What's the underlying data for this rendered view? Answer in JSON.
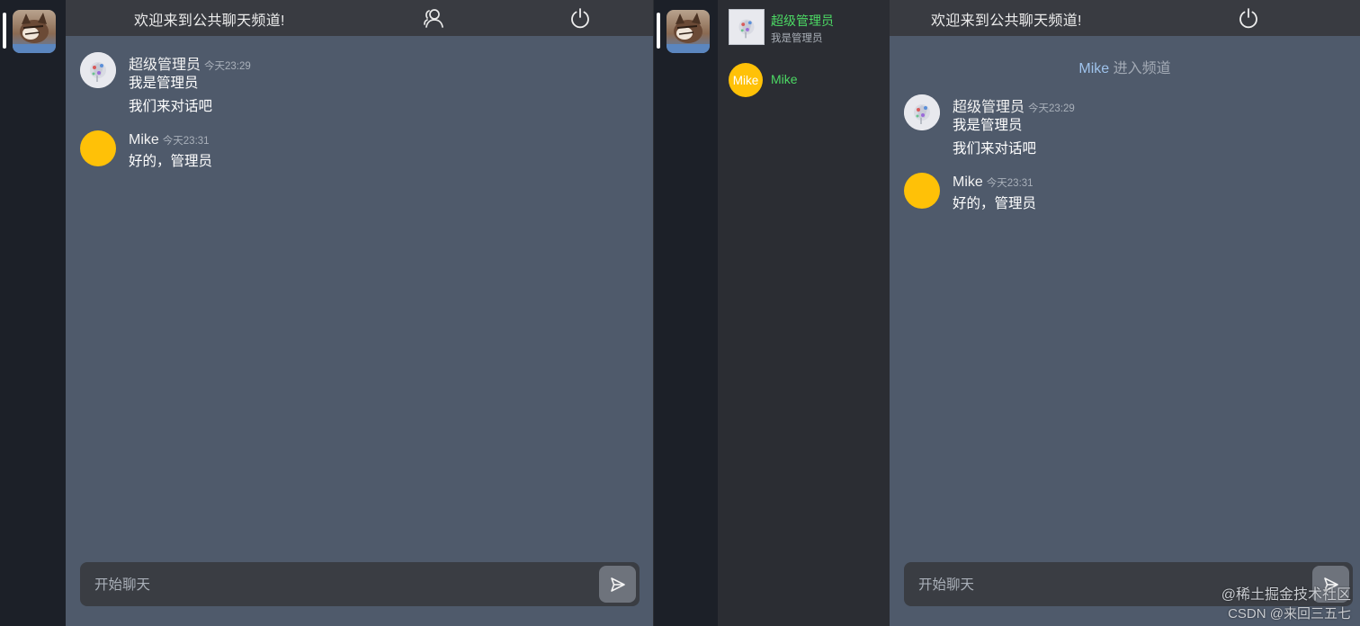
{
  "left_window": {
    "header": {
      "title": "欢迎来到公共聊天频道!"
    },
    "messages": [
      {
        "name": "超级管理员",
        "time": "今天23:29",
        "lines": [
          "我是管理员",
          "我们来对话吧"
        ]
      },
      {
        "name": "Mike",
        "time": "今天23:31",
        "lines": [
          "好的，管理员"
        ]
      }
    ],
    "input": {
      "placeholder": "开始聊天"
    }
  },
  "right_window": {
    "members": [
      {
        "name": "超级管理员",
        "subtitle": "我是管理员"
      },
      {
        "name": "Mike",
        "avatar_text": "Mike"
      }
    ],
    "header": {
      "title": "欢迎来到公共聊天频道!"
    },
    "system_note": {
      "who": "Mike",
      "what": " 进入频道"
    },
    "messages": [
      {
        "name": "超级管理员",
        "time": "今天23:29",
        "lines": [
          "我是管理员",
          "我们来对话吧"
        ]
      },
      {
        "name": "Mike",
        "time": "今天23:31",
        "lines": [
          "好的，管理员"
        ]
      }
    ],
    "input": {
      "placeholder": "开始聊天"
    }
  },
  "watermark": {
    "line1": "@稀土掘金技术社区",
    "line2": "CSDN @来回三五七"
  },
  "colors": {
    "rail": "#1c2028",
    "chat_bg": "#4f5a6b",
    "header_bg": "#393b41",
    "member_list_bg": "#2b2d33",
    "member_name": "#4cd964",
    "avatar_yellow": "#ffc107",
    "system_name": "#9fc3ec"
  },
  "icons": [
    "user-avatar-cat",
    "users-icon",
    "power-icon",
    "send-icon",
    "admin-avatar"
  ]
}
